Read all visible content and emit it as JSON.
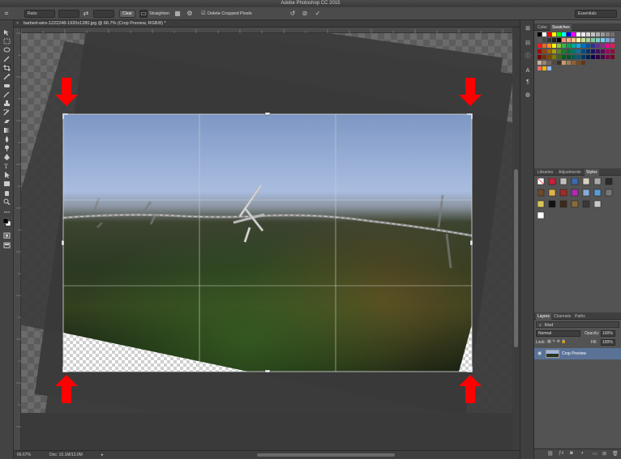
{
  "window": {
    "title": "Adobe Photoshop CC 2015"
  },
  "options_bar": {
    "ratio_label": "Ratio",
    "clear_label": "Clear",
    "straighten_label": "Straighten",
    "delete_cropped_label": "Delete Cropped Pixels",
    "workspace_label": "Essentials"
  },
  "document": {
    "tab_label": "barbed-wire-1222248-1920x1280.jpg @ 66.7% (Crop Preview, RGB/8) *",
    "close_glyph": "×"
  },
  "status": {
    "zoom": "66.67%",
    "doc_size": "Doc: 10.1M/13.0M"
  },
  "panels": {
    "color_tab": "Color",
    "swatches_tab": "Swatches",
    "libraries_tab": "Libraries",
    "adjustments_tab": "Adjustments",
    "styles_tab": "Styles",
    "layers_tab": "Layers",
    "channels_tab": "Channels",
    "paths_tab": "Paths",
    "kind_label": "Kind",
    "blend_mode": "Normal",
    "opacity_label": "Opacity:",
    "opacity_value": "100%",
    "lock_label": "Lock:",
    "fill_label": "Fill:",
    "fill_value": "100%",
    "layer_name": "Crop Preview"
  },
  "colors": {
    "arrow_red": "#ff0000",
    "sky_top": "#7d97c4",
    "sky_bottom": "#a9bde0",
    "ground": "#1e2b17"
  }
}
